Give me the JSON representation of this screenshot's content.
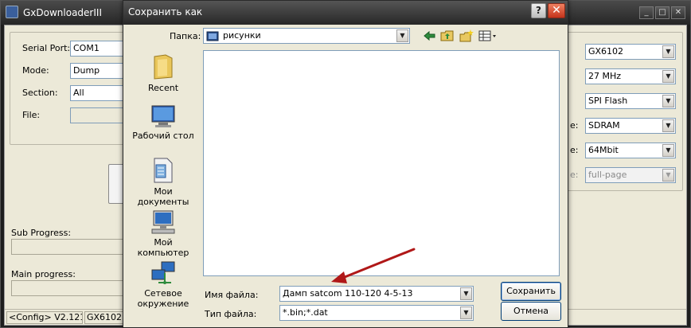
{
  "main_window": {
    "title": "GxDownloaderIII",
    "controls": {
      "minimize": "_",
      "maximize": "□",
      "close": "✕"
    },
    "left_panel": {
      "serial_port_label": "Serial Port:",
      "serial_port_value": "COM1",
      "mode_label": "Mode:",
      "mode_value": "Dump",
      "section_label": "Section:",
      "section_value": "All",
      "file_label": "File:",
      "file_value": ""
    },
    "right_panel": {
      "chip_value": "GX6102",
      "crystal_value": "27 MHz",
      "flash_value": "SPI Flash",
      "ram_label_tail": "e:",
      "ram_value": "SDRAM",
      "size_label_tail": "e:",
      "size_value": "64Mbit",
      "page_label_tail": "e:",
      "page_value": "full-page"
    },
    "sub_progress_label": "Sub Progress:",
    "main_progress_label": "Main progress:",
    "status": {
      "config": "<Config> V2.121",
      "chip": "GX6102 /"
    }
  },
  "dialog": {
    "title": "Сохранить как",
    "help": "?",
    "close": "✕",
    "folder_label": "Папка:",
    "folder_value": "рисунки",
    "places": [
      {
        "label": "Recent"
      },
      {
        "label": "Рабочий стол"
      },
      {
        "label": "Мои документы"
      },
      {
        "label": "Мой компьютер"
      },
      {
        "label": "Сетевое окружение"
      }
    ],
    "filename_label": "Имя файла:",
    "filename_value": "Дамп satcom 110-120  4-5-13",
    "filetype_label": "Тип файла:",
    "filetype_value": "*.bin;*.dat",
    "save_button": "Сохранить",
    "cancel_button": "Отмена"
  },
  "colors": {
    "arrow": "#b01818",
    "title_bar": "#2a2a2a",
    "window_bg": "#ece9d8",
    "close_button": "#c4341c"
  },
  "icons": [
    "app-icon",
    "folder-icon",
    "back-arrow-icon",
    "up-folder-icon",
    "new-folder-icon",
    "view-menu-icon",
    "recent-folder-icon",
    "desktop-icon",
    "documents-icon",
    "computer-icon",
    "network-icon",
    "dropdown-arrow-icon"
  ]
}
